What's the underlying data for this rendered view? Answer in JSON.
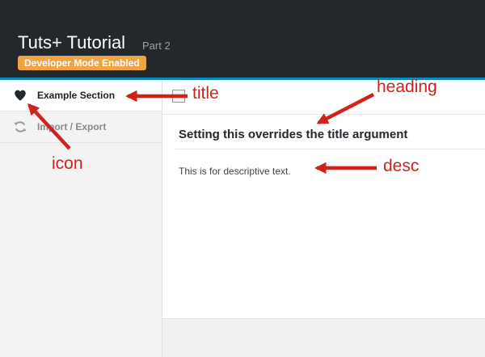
{
  "header": {
    "title": "Tuts+ Tutorial",
    "subtitle": "Part 2",
    "badge": "Developer Mode Enabled"
  },
  "sidebar": {
    "items": [
      {
        "label": "Example Section",
        "icon": "heart-icon",
        "active": true
      },
      {
        "label": "Import / Export",
        "icon": "refresh-icon",
        "active": false
      }
    ]
  },
  "main": {
    "heading": "Setting this overrides the title argument",
    "description": "This is for descriptive text."
  },
  "annotations": {
    "title": "title",
    "heading": "heading",
    "desc": "desc",
    "icon": "icon"
  },
  "colors": {
    "header_bg": "#23282d",
    "header_accent": "#0a8ab8",
    "badge_bg": "#f0a340",
    "annotation": "#d0211d"
  }
}
